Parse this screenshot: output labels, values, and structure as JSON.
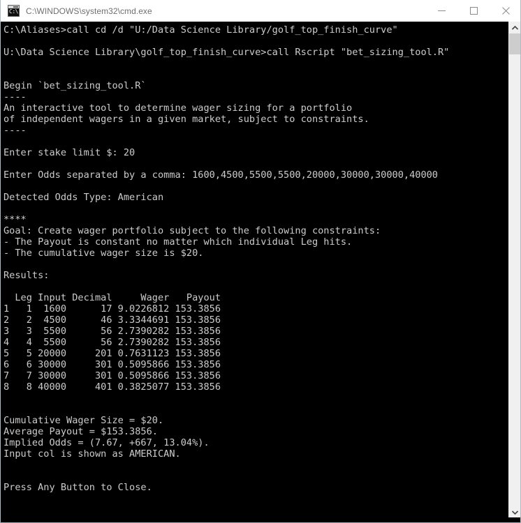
{
  "window": {
    "title": "C:\\WINDOWS\\system32\\cmd.exe",
    "icon": "cmd-console-icon",
    "icon_glyph": "C:\\",
    "controls": {
      "minimize_label": "Minimize",
      "maximize_label": "Maximize",
      "close_label": "Close"
    },
    "colors": {
      "titlebar_background": "#ffffff",
      "titlebar_text": "#6f6f6f",
      "console_background": "#000000",
      "console_text": "#cccccc",
      "scrollbar_track": "#f0f0f0",
      "scrollbar_thumb": "#cdcdcd"
    }
  },
  "scrollbar": {
    "up_arrow": "chevron-up-icon",
    "down_arrow": "chevron-down-icon",
    "thumb_position_percent": 0
  },
  "console": {
    "prompt_lines": [
      "C:\\Aliases>call cd /d \"U:/Data Science Library/golf_top_finish_curve\"",
      "U:\\Data Science Library\\golf_top_finish_curve>call Rscript \"bet_sizing_tool.R\""
    ],
    "banner": {
      "begin_line": "Begin `bet_sizing_tool.R`",
      "rule": "----",
      "description_line_1": "An interactive tool to determine wager sizing for a portfolio",
      "description_line_2": "of independent wagers in a given market, subject to constraints."
    },
    "inputs": {
      "stake_limit_prompt": "Enter stake limit $: ",
      "stake_limit_value": "20",
      "odds_prompt": "Enter Odds separated by a comma: ",
      "odds_value": "1600,4500,5500,5500,20000,30000,30000,40000",
      "detected_odds_type_label": "Detected Odds Type: ",
      "detected_odds_type_value": "American"
    },
    "goal": {
      "stars": "****",
      "heading": "Goal: Create wager portfolio subject to the following constraints:",
      "constraints": [
        "- The Payout is constant no matter which individual Leg hits.",
        "- The cumulative wager size is $20."
      ],
      "results_label": "Results:"
    },
    "table": {
      "headers": [
        "",
        "Leg",
        "Input",
        "Decimal",
        "Wager",
        "Payout"
      ],
      "rows": [
        {
          "index": "1",
          "leg": "1",
          "input": "1600",
          "decimal": "17",
          "wager": "9.0226812",
          "payout": "153.3856"
        },
        {
          "index": "2",
          "leg": "2",
          "input": "4500",
          "decimal": "46",
          "wager": "3.3344691",
          "payout": "153.3856"
        },
        {
          "index": "3",
          "leg": "3",
          "input": "5500",
          "decimal": "56",
          "wager": "2.7390282",
          "payout": "153.3856"
        },
        {
          "index": "4",
          "leg": "4",
          "input": "5500",
          "decimal": "56",
          "wager": "2.7390282",
          "payout": "153.3856"
        },
        {
          "index": "5",
          "leg": "5",
          "input": "20000",
          "decimal": "201",
          "wager": "0.7631123",
          "payout": "153.3856"
        },
        {
          "index": "6",
          "leg": "6",
          "input": "30000",
          "decimal": "301",
          "wager": "0.5095866",
          "payout": "153.3856"
        },
        {
          "index": "7",
          "leg": "7",
          "input": "30000",
          "decimal": "301",
          "wager": "0.5095866",
          "payout": "153.3856"
        },
        {
          "index": "8",
          "leg": "8",
          "input": "40000",
          "decimal": "401",
          "wager": "0.3825077",
          "payout": "153.3856"
        }
      ]
    },
    "summary": {
      "cumulative_wager_size": "Cumulative Wager Size = $20.",
      "average_payout": "Average Payout = $153.3856.",
      "implied_odds": "Implied Odds = (7.67, +667, 13.04%).",
      "input_col_note": "Input col is shown as AMERICAN."
    },
    "footer": {
      "press_any_button": "Press Any Button to Close."
    },
    "full_text": "C:\\Aliases>call cd /d \"U:/Data Science Library/golf_top_finish_curve\"\n\nU:\\Data Science Library\\golf_top_finish_curve>call Rscript \"bet_sizing_tool.R\"\n\n\nBegin `bet_sizing_tool.R`\n----\nAn interactive tool to determine wager sizing for a portfolio\nof independent wagers in a given market, subject to constraints.\n----\n\nEnter stake limit $: 20\n\nEnter Odds separated by a comma: 1600,4500,5500,5500,20000,30000,30000,40000\n\nDetected Odds Type: American\n\n****\nGoal: Create wager portfolio subject to the following constraints:\n- The Payout is constant no matter which individual Leg hits.\n- The cumulative wager size is $20.\n\nResults:\n\n  Leg Input Decimal     Wager   Payout\n1   1  1600      17 9.0226812 153.3856\n2   2  4500      46 3.3344691 153.3856\n3   3  5500      56 2.7390282 153.3856\n4   4  5500      56 2.7390282 153.3856\n5   5 20000     201 0.7631123 153.3856\n6   6 30000     301 0.5095866 153.3856\n7   7 30000     301 0.5095866 153.3856\n8   8 40000     401 0.3825077 153.3856\n\n\nCumulative Wager Size = $20.\nAverage Payout = $153.3856.\nImplied Odds = (7.67, +667, 13.04%).\nInput col is shown as AMERICAN.\n\n\nPress Any Button to Close."
  }
}
